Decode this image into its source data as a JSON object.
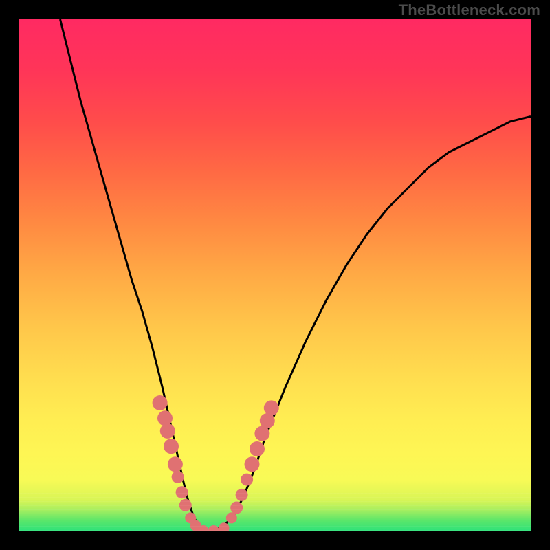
{
  "watermark": "TheBottleneck.com",
  "colors": {
    "frame": "#000000",
    "curve": "#000000",
    "marker": "#e07172",
    "gradient_top": "#ff2a62",
    "gradient_mid": "#ffed52",
    "gradient_bottom": "#2fe279"
  },
  "chart_data": {
    "type": "line",
    "title": "",
    "xlabel": "",
    "ylabel": "",
    "xlim": [
      0,
      100
    ],
    "ylim": [
      0,
      100
    ],
    "grid": false,
    "legend": false,
    "series": [
      {
        "name": "curve",
        "x": [
          8,
          10,
          12,
          14,
          16,
          18,
          20,
          22,
          24,
          26,
          28,
          30,
          32,
          33,
          34,
          35,
          36,
          38,
          40,
          42,
          44,
          46,
          48,
          52,
          56,
          60,
          64,
          68,
          72,
          76,
          80,
          84,
          88,
          92,
          96,
          100
        ],
        "values": [
          100,
          92,
          84,
          77,
          70,
          63,
          56,
          49,
          43,
          36,
          28,
          19,
          10,
          6,
          3,
          1,
          0,
          0,
          1,
          3,
          7,
          12,
          18,
          28,
          37,
          45,
          52,
          58,
          63,
          67,
          71,
          74,
          76,
          78,
          80,
          81
        ]
      }
    ],
    "markers": {
      "name": "highlighted-points",
      "x": [
        27.5,
        28.5,
        29.0,
        29.7,
        30.5,
        31.0,
        31.8,
        32.5,
        33.5,
        34.5,
        36.0,
        38.0,
        40.0,
        41.5,
        42.5,
        43.5,
        44.5,
        45.5,
        46.5,
        47.5,
        48.5,
        49.3
      ],
      "values": [
        25.0,
        22.0,
        19.5,
        16.5,
        13.0,
        10.5,
        7.5,
        5.0,
        2.5,
        1.0,
        0.0,
        0.0,
        0.5,
        2.5,
        4.5,
        7.0,
        10.0,
        13.0,
        16.0,
        19.0,
        21.5,
        24.0
      ]
    }
  }
}
